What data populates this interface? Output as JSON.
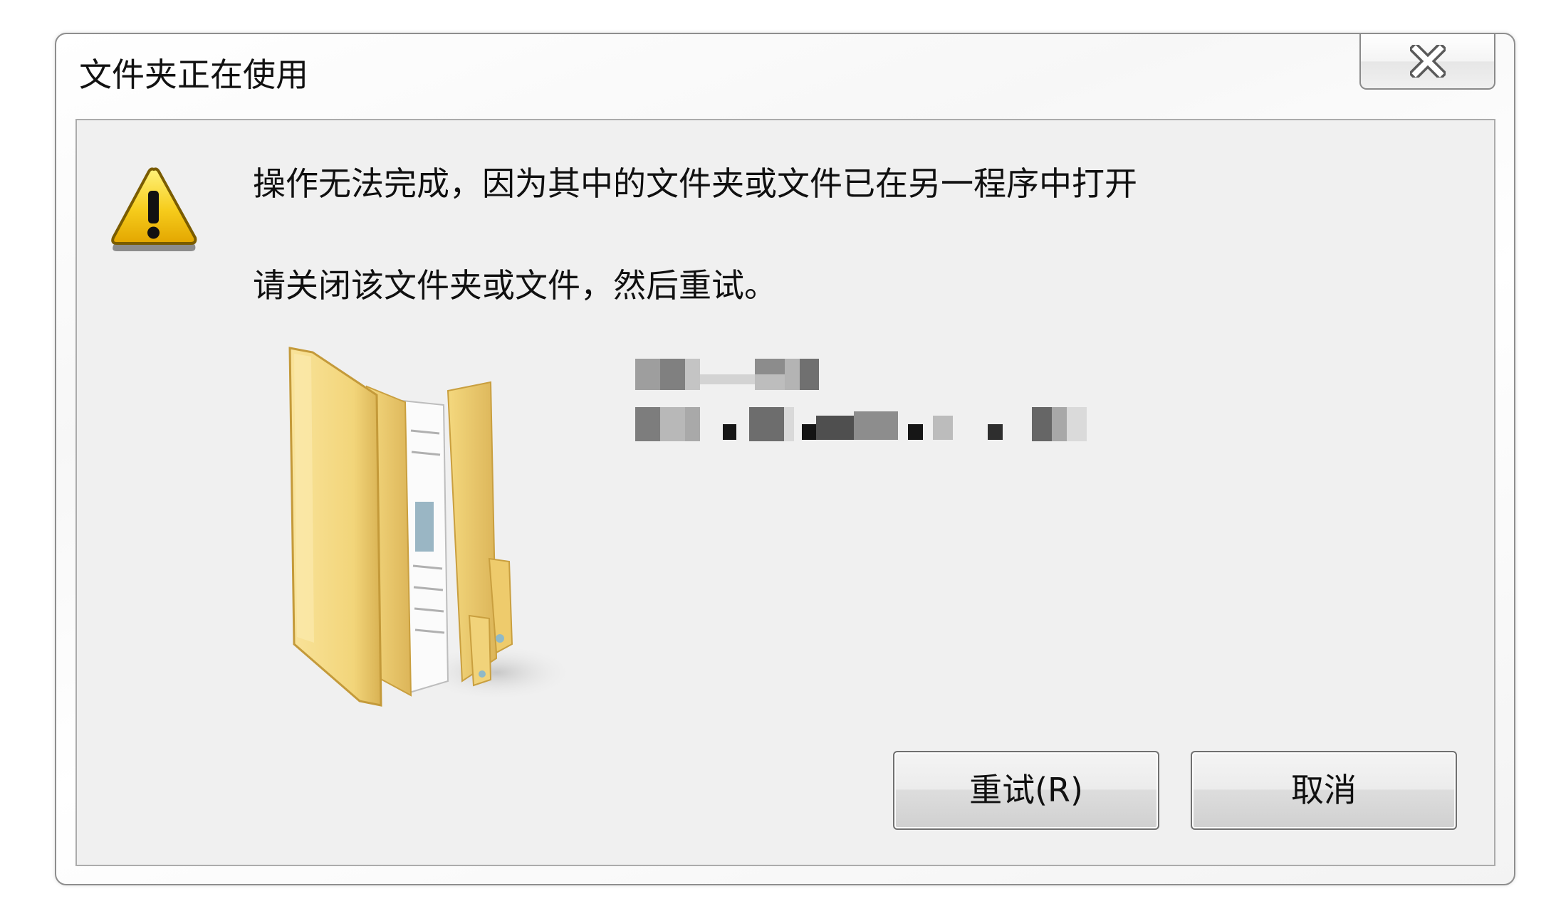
{
  "window": {
    "title": "文件夹正在使用"
  },
  "message": {
    "primary": "操作无法完成，因为其中的文件夹或文件已在另一程序中打开",
    "secondary": "请关闭该文件夹或文件，然后重试。"
  },
  "buttons": {
    "retry": "重试(R)",
    "cancel": "取消"
  },
  "icons": {
    "close": "close-icon",
    "warning": "warning-icon",
    "folder": "folder-icon"
  },
  "colors": {
    "panel_background": "#f0f0f0",
    "warning_yellow": "#f6cc1c",
    "folder_yellow": "#f2d57a",
    "button_border": "#707070"
  }
}
